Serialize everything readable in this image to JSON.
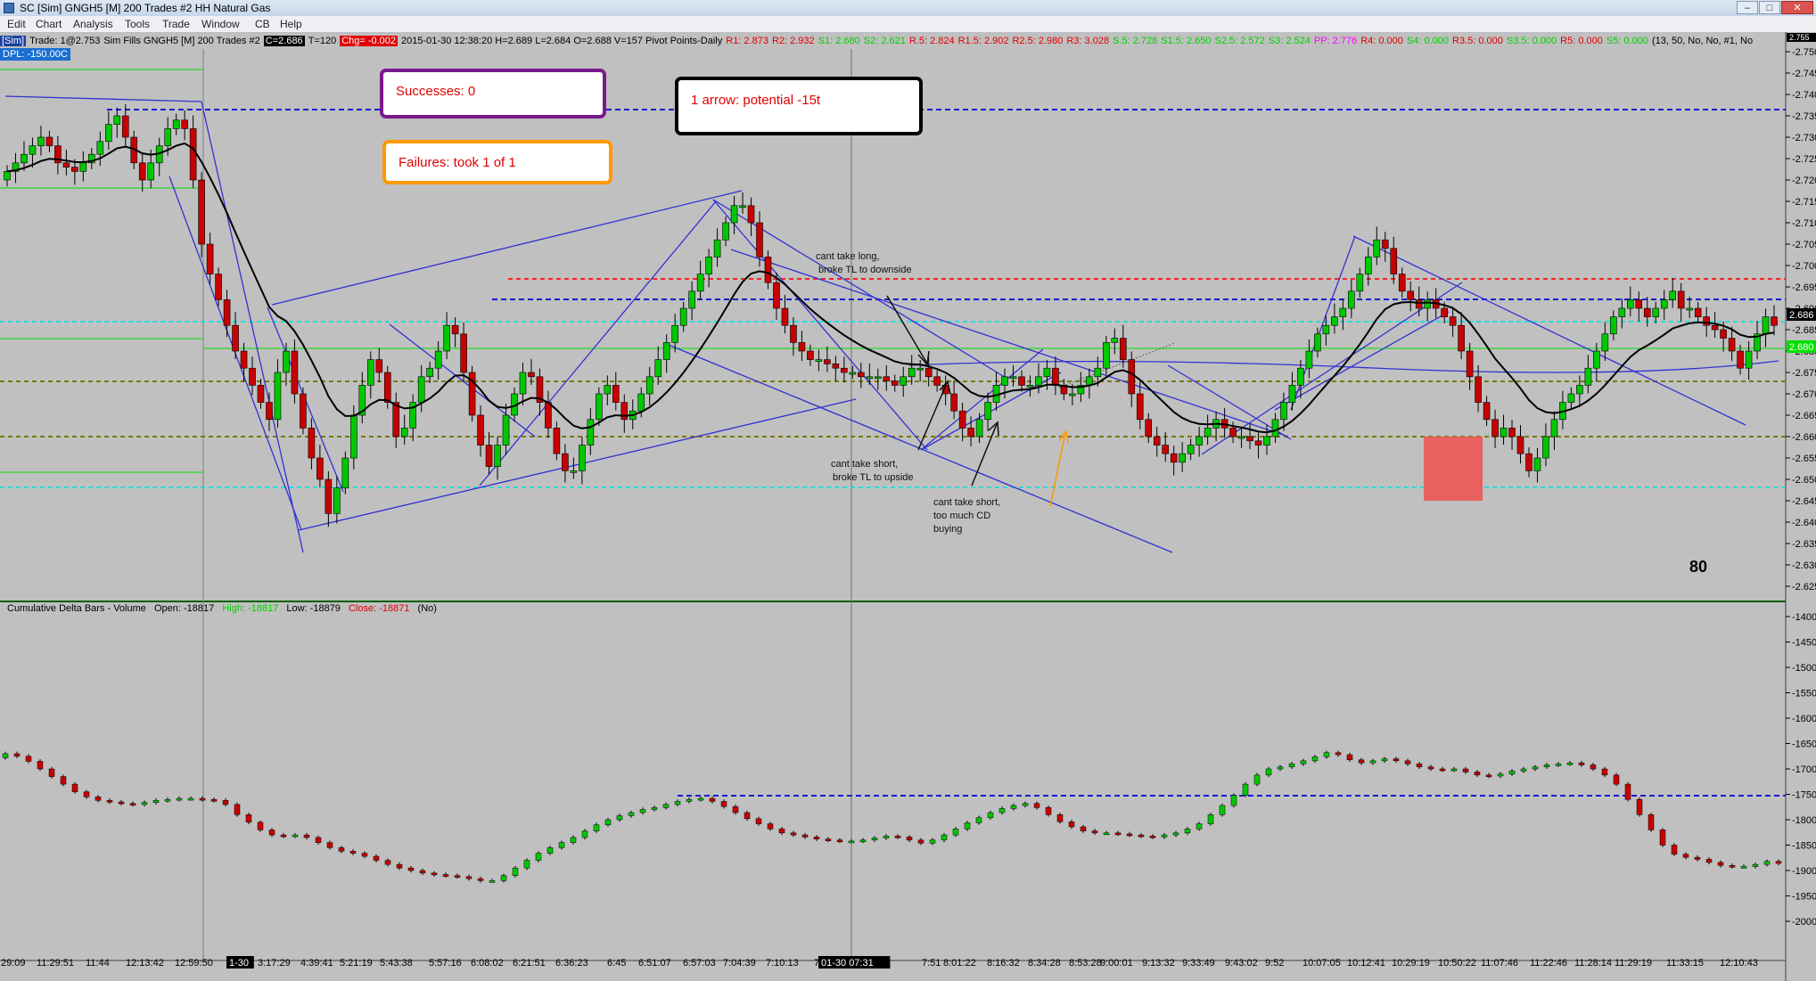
{
  "window": {
    "title": "SC [Sim] GNGH5 [M]  200 Trades  #2  HH Natural Gas",
    "controls": [
      "–",
      "□",
      "✕"
    ]
  },
  "menu": [
    "Edit",
    "Chart",
    "Analysis",
    "Tools",
    "Trade",
    "Window",
    "CB",
    "Help"
  ],
  "info": {
    "sim_tag": "[Sim]",
    "trade": "Trade: 1@2.753",
    "symbol": "Sim Fills  GNGH5 [M]  200 Trades  #2",
    "last": "C=2.686",
    "ticks": "T=120",
    "change": "Chg= -0.002",
    "ohlc": "2015-01-30 12:38:20 H=2.689 L=2.684 O=2.688 V=157 Pivot Points-Daily",
    "r1": "R1: 2.873",
    "r2": "R2: 2.932",
    "s1": "S1: 2.680",
    "s2": "S2: 2.621",
    "r05": "R.5: 2.824",
    "r15": "R1.5: 2.902",
    "r25": "R2.5: 2.980",
    "r3": "R3: 3.028",
    "s05": "S.5: 2.728",
    "s15": "S1.5: 2.650",
    "s25": "S2.5: 2.572",
    "s3": "S3: 2.524",
    "pp": "PP: 2.776",
    "r4": "R4: 0.000",
    "s4": "S4: 0.000",
    "r35": "R3.5: 0.000",
    "s35": "S3.5: 0.000",
    "r5": "R5: 0.000",
    "s5": "S5: 0.000",
    "params": "(13, 50, No, No, #1, No",
    "dpl": "DPL: -150.00C"
  },
  "boxes": {
    "successes": "Successes: 0",
    "failures": "Failures: took 1 of 1",
    "arrow": "1 arrow: potential -15t"
  },
  "annotations": {
    "long1": "cant take long,",
    "long2": "broke TL to downside",
    "short1a": "cant take short,",
    "short1b": "broke TL to upside",
    "short2a": "cant take short,",
    "short2b": "too much CD",
    "short2c": "buying",
    "count": "80"
  },
  "price_axis": {
    "labels": [
      "2.750",
      "2.745",
      "2.740",
      "2.735",
      "2.730",
      "2.725",
      "2.720",
      "2.715",
      "2.710",
      "2.705",
      "2.700",
      "2.695",
      "2.690",
      "2.685",
      "2.680",
      "2.675",
      "2.670",
      "2.665",
      "2.660",
      "2.655",
      "2.650",
      "2.645",
      "2.640",
      "2.635",
      "2.630",
      "2.625"
    ],
    "current_badge": "2.686",
    "s1_badge": "2.680",
    "top_badge": "2.755"
  },
  "lower_panel": {
    "name": "Cumulative Delta Bars - Volume",
    "open": "Open: -18817",
    "high": "High: -18817",
    "low": "Low: -18879",
    "close": "Close: -18871",
    "flag": "(No)",
    "axis": [
      "-1400",
      "-1450",
      "-1500",
      "-1550",
      "-1600",
      "-1650",
      "-1700",
      "-1750",
      "-1800",
      "-1850",
      "-1900",
      "-1950",
      "-2000"
    ]
  },
  "time_axis": [
    "29:09",
    "11:29:51",
    "11:44",
    "12:13:42",
    "12:59:50",
    "1-30",
    "3:17:29",
    "4:39:41",
    "5:21:19",
    "5:43:38",
    "5:57:16",
    "6:08:02",
    "6:21:51",
    "6:36:23",
    "6:45",
    "6:51:07",
    "6:57:03",
    "7:04:39",
    "7:10:13",
    "7:4",
    "01-30  07:31",
    "7:51",
    "8:01:22",
    "8:16:32",
    "8:34:28",
    "8:53:28",
    "9:00:01",
    "9:13:32",
    "9:33:49",
    "9:43:02",
    "9:52",
    "10:07:05",
    "10:12:41",
    "10:29:19",
    "10:50:22",
    "11:07:46",
    "11:22:46",
    "11:28:14",
    "11:29:19",
    "11:33:15",
    "12:10:43"
  ],
  "colors": {
    "background": "#c0c0c0",
    "up_candle": "#00c800",
    "down_candle": "#c80000",
    "trendline": "#3232d2",
    "ma_line": "#000000",
    "red_dash": "#ff2020",
    "blue_dash": "#1a1ad0",
    "cyan_dash": "#00e0e0",
    "olive_dash": "#7a7a00",
    "s1_line": "#00e000",
    "box_purple": "#7a1a8c",
    "box_orange": "#ff9900",
    "box_black": "#000000",
    "red_zone": "#e86060",
    "orange_arrow": "#ff9900"
  },
  "chart_data": {
    "type": "candlestick",
    "price_series": [
      2.722,
      2.724,
      2.726,
      2.728,
      2.73,
      2.728,
      2.724,
      2.723,
      2.722,
      2.724,
      2.726,
      2.729,
      2.733,
      2.735,
      2.73,
      2.724,
      2.72,
      2.724,
      2.728,
      2.732,
      2.734,
      2.732,
      2.72,
      2.705,
      2.698,
      2.692,
      2.686,
      2.68,
      2.676,
      2.672,
      2.668,
      2.664,
      2.675,
      2.68,
      2.67,
      2.662,
      2.655,
      2.65,
      2.642,
      2.648,
      2.655,
      2.665,
      2.672,
      2.678,
      2.675,
      2.668,
      2.66,
      2.662,
      2.668,
      2.674,
      2.676,
      2.68,
      2.686,
      2.684,
      2.675,
      2.665,
      2.658,
      2.653,
      2.658,
      2.665,
      2.67,
      2.675,
      2.674,
      2.668,
      2.662,
      2.656,
      2.652,
      2.652,
      2.658,
      2.664,
      2.67,
      2.672,
      2.668,
      2.664,
      2.666,
      2.67,
      2.674,
      2.678,
      2.682,
      2.686,
      2.69,
      2.694,
      2.698,
      2.702,
      2.706,
      2.71,
      2.714,
      2.714,
      2.71,
      2.702,
      2.696,
      2.69,
      2.686,
      2.682,
      2.68,
      2.678,
      2.678,
      2.677,
      2.676,
      2.675,
      2.675,
      2.674,
      2.674,
      2.674,
      2.673,
      2.672,
      2.674,
      2.676,
      2.676,
      2.674,
      2.672,
      2.67,
      2.666,
      2.662,
      2.66,
      2.664,
      2.668,
      2.672,
      2.674,
      2.674,
      2.672,
      2.672,
      2.674,
      2.676,
      2.672,
      2.67,
      2.67,
      2.672,
      2.674,
      2.676,
      2.682,
      2.683,
      2.678,
      2.67,
      2.664,
      2.66,
      2.658,
      2.656,
      2.654,
      2.656,
      2.658,
      2.66,
      2.662,
      2.664,
      2.662,
      2.66,
      2.66,
      2.659,
      2.658,
      2.66,
      2.664,
      2.668,
      2.672,
      2.676,
      2.68,
      2.684,
      2.686,
      2.688,
      2.69,
      2.694,
      2.698,
      2.702,
      2.706,
      2.704,
      2.698,
      2.694,
      2.692,
      2.69,
      2.692,
      2.69,
      2.688,
      2.686,
      2.68,
      2.674,
      2.668,
      2.664,
      2.66,
      2.662,
      2.66,
      2.656,
      2.652,
      2.655,
      2.66,
      2.664,
      2.668,
      2.67,
      2.672,
      2.676,
      2.68,
      2.684,
      2.688,
      2.69,
      2.692,
      2.69,
      2.688,
      2.69,
      2.692,
      2.694,
      2.69,
      2.69,
      2.688,
      2.686,
      2.685,
      2.683,
      2.68,
      2.676,
      2.68,
      2.684,
      2.688,
      2.686
    ],
    "cd_series": [
      -1670,
      -1675,
      -1685,
      -1700,
      -1715,
      -1730,
      -1745,
      -1755,
      -1762,
      -1765,
      -1768,
      -1770,
      -1766,
      -1762,
      -1760,
      -1758,
      -1758,
      -1760,
      -1762,
      -1770,
      -1790,
      -1805,
      -1820,
      -1830,
      -1832,
      -1830,
      -1835,
      -1845,
      -1855,
      -1862,
      -1866,
      -1872,
      -1880,
      -1888,
      -1895,
      -1900,
      -1905,
      -1908,
      -1910,
      -1912,
      -1916,
      -1920,
      -1920,
      -1910,
      -1895,
      -1880,
      -1866,
      -1855,
      -1845,
      -1835,
      -1822,
      -1810,
      -1800,
      -1792,
      -1786,
      -1780,
      -1776,
      -1770,
      -1764,
      -1760,
      -1758,
      -1764,
      -1774,
      -1786,
      -1798,
      -1808,
      -1818,
      -1826,
      -1830,
      -1834,
      -1838,
      -1840,
      -1842,
      -1842,
      -1840,
      -1836,
      -1832,
      -1834,
      -1840,
      -1846,
      -1840,
      -1830,
      -1818,
      -1806,
      -1796,
      -1786,
      -1778,
      -1772,
      -1768,
      -1776,
      -1790,
      -1804,
      -1814,
      -1822,
      -1826,
      -1826,
      -1828,
      -1830,
      -1832,
      -1834,
      -1830,
      -1826,
      -1818,
      -1808,
      -1790,
      -1772,
      -1752,
      -1730,
      -1712,
      -1700,
      -1696,
      -1690,
      -1684,
      -1676,
      -1668,
      -1672,
      -1682,
      -1688,
      -1684,
      -1680,
      -1684,
      -1690,
      -1696,
      -1700,
      -1702,
      -1700,
      -1706,
      -1712,
      -1714,
      -1710,
      -1704,
      -1700,
      -1696,
      -1692,
      -1690,
      -1688,
      -1692,
      -1700,
      -1712,
      -1730,
      -1760,
      -1790,
      -1820,
      -1850,
      -1868,
      -1874,
      -1878,
      -1884,
      -1890,
      -1892,
      -1892,
      -1888,
      -1882,
      -1886
    ],
    "price_ylim": [
      2.622,
      2.756
    ],
    "cd_ylim": [
      -2010,
      -1390
    ]
  }
}
